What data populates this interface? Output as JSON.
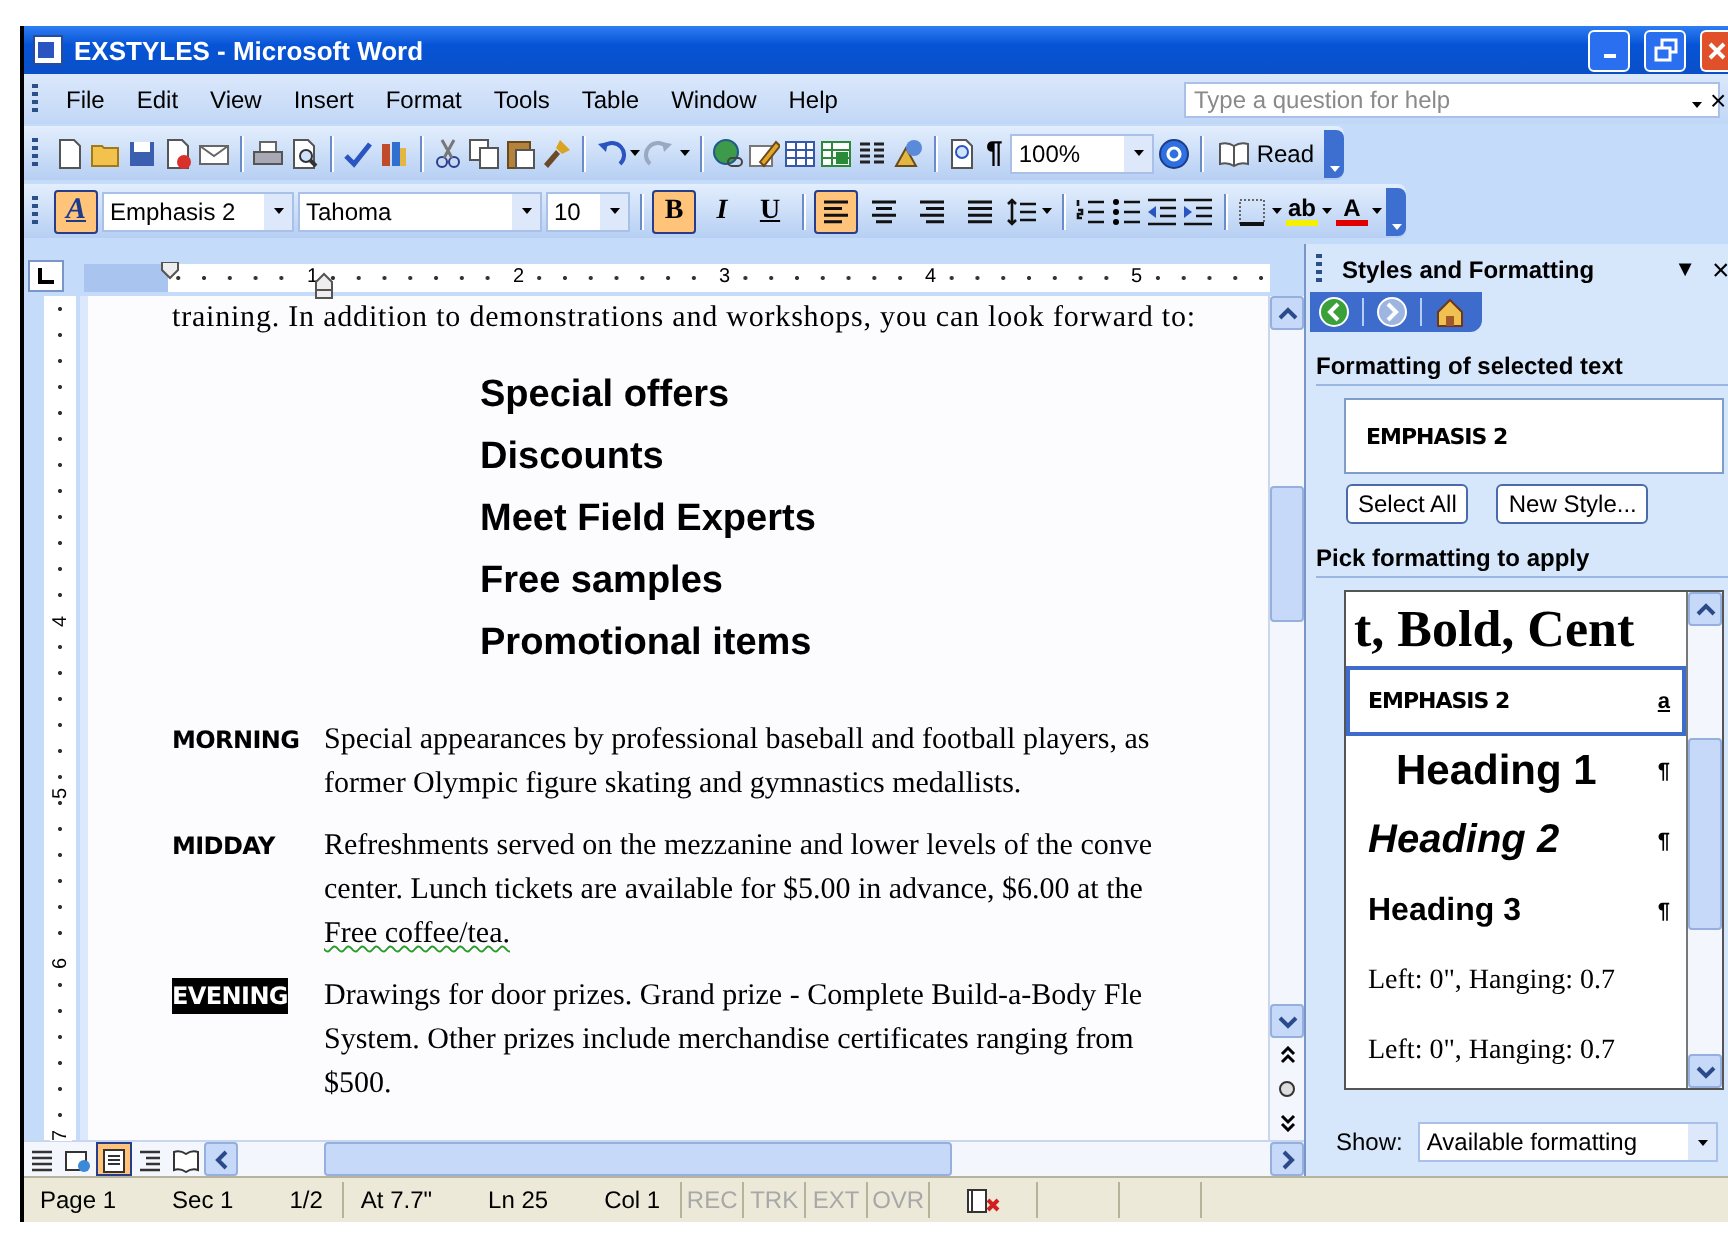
{
  "window": {
    "title": "EXSTYLES - Microsoft Word",
    "doc_close": "×"
  },
  "menu": [
    "File",
    "Edit",
    "View",
    "Insert",
    "Format",
    "Tools",
    "Table",
    "Window",
    "Help"
  ],
  "help_box": {
    "placeholder": "Type a question for help"
  },
  "standard_toolbar": {
    "pilcrow": "¶",
    "zoom": "100%",
    "read": "Read"
  },
  "formatting_toolbar": {
    "styles_glyph": "A",
    "styles_selected": true,
    "style": "Emphasis 2",
    "font": "Tahoma",
    "size": "10",
    "toggles": [
      {
        "label": "B",
        "kind": "bold",
        "selected": true
      },
      {
        "label": "I",
        "kind": "italic",
        "selected": false
      },
      {
        "label": "U",
        "kind": "underline",
        "selected": false
      }
    ],
    "alignments": [
      {
        "kind": "left",
        "selected": true
      },
      {
        "kind": "center",
        "selected": false
      },
      {
        "kind": "right",
        "selected": false
      },
      {
        "kind": "justify",
        "selected": false
      }
    ],
    "highlight_glyph": "ab",
    "font_color_glyph": "A"
  },
  "ruler": {
    "labels": [
      "1",
      "2",
      "3",
      "4",
      "5"
    ],
    "vertical_labels": [
      "4",
      "5",
      "6",
      "7"
    ]
  },
  "document": {
    "intro": "training. In addition to demonstrations and workshops, you can look forward to:",
    "offers": [
      "Special offers",
      "Discounts",
      "Meet Field Experts",
      "Free samples",
      "Promotional items"
    ],
    "schedule": [
      {
        "label": "MORNING",
        "selected": false,
        "lines": [
          {
            "text": "Special appearances by professional baseball and football players, as",
            "flagged": false
          },
          {
            "text": "former Olympic figure skating and gymnastics medallists.",
            "flagged": false
          }
        ]
      },
      {
        "label": "MIDDAY",
        "selected": false,
        "lines": [
          {
            "text": "Refreshments served on the mezzanine and lower levels of the conve",
            "flagged": false
          },
          {
            "text": "center. Lunch tickets are available for $5.00 in advance, $6.00 at the",
            "flagged": false
          },
          {
            "text": "Free coffee/tea.",
            "flagged": true
          }
        ]
      },
      {
        "label": "EVENING",
        "selected": true,
        "lines": [
          {
            "text": "Drawings for door prizes.  Grand prize - Complete Build-a-Body Fle",
            "flagged": false
          },
          {
            "text": "System. Other prizes include merchandise certificates ranging from",
            "flagged": false
          },
          {
            "text": "$500.",
            "flagged": false
          }
        ]
      }
    ]
  },
  "views": [
    {
      "kind": "normal",
      "selected": false
    },
    {
      "kind": "web",
      "selected": false
    },
    {
      "kind": "print",
      "selected": true
    },
    {
      "kind": "outline",
      "selected": false
    },
    {
      "kind": "reading",
      "selected": false
    }
  ],
  "task_pane": {
    "title": "Styles and Formatting",
    "menu_glyph": "▼",
    "close_glyph": "×",
    "nav": [
      {
        "kind": "back",
        "disabled": false
      },
      {
        "kind": "forward",
        "disabled": true
      },
      {
        "kind": "home",
        "disabled": false
      }
    ],
    "selected_heading": "Formatting of selected text",
    "selected_style": "EMPHASIS 2",
    "buttons": [
      "Select All",
      "New Style..."
    ],
    "pick_heading": "Pick formatting to apply",
    "styles": [
      {
        "kind": "cut",
        "text": "t, Bold, Cent",
        "selected": false
      },
      {
        "kind": "emphasis",
        "text": "EMPHASIS 2",
        "mark": "a",
        "selected": true
      },
      {
        "kind": "heading1",
        "text": "Heading 1",
        "mark": "¶",
        "selected": false
      },
      {
        "kind": "heading2",
        "text": "Heading 2",
        "mark": "¶",
        "selected": false
      },
      {
        "kind": "heading3",
        "text": "Heading 3",
        "mark": "¶",
        "selected": false
      },
      {
        "kind": "plain",
        "text": "Left:  0\", Hanging:  0.7",
        "selected": false
      },
      {
        "kind": "plain",
        "text": "Left:  0\", Hanging:  0.7",
        "selected": false
      }
    ],
    "show_label": "Show:",
    "show_value": "Available formatting"
  },
  "status_bar": {
    "groups": [
      [
        "Page 1",
        "Sec 1",
        "1/2"
      ],
      [
        "At 7.7\"",
        "Ln 25",
        "Col 1"
      ]
    ],
    "modes": [
      {
        "label": "REC",
        "on": false
      },
      {
        "label": "TRK",
        "on": false
      },
      {
        "label": "EXT",
        "on": false
      },
      {
        "label": "OVR",
        "on": false
      }
    ]
  }
}
